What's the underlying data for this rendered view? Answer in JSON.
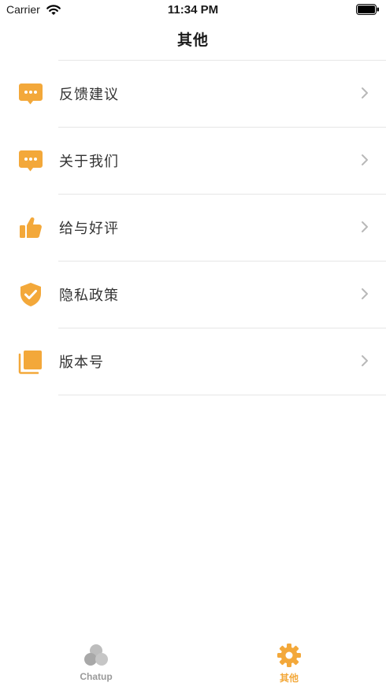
{
  "status_bar": {
    "carrier": "Carrier",
    "time": "11:34 PM",
    "wifi_icon": "wifi-icon",
    "battery_icon": "battery-icon"
  },
  "header": {
    "title": "其他"
  },
  "colors": {
    "accent": "#f3a83a",
    "inactive": "#9a9a9a",
    "divider": "#e6e6e6",
    "chevron": "#b8b8b8"
  },
  "menu": {
    "items": [
      {
        "label": "反馈建议",
        "icon": "chat-bubble-icon"
      },
      {
        "label": "关于我们",
        "icon": "chat-bubble-icon"
      },
      {
        "label": "给与好评",
        "icon": "thumbs-up-icon"
      },
      {
        "label": "隐私政策",
        "icon": "shield-check-icon"
      },
      {
        "label": "版本号",
        "icon": "stacked-pages-icon"
      }
    ]
  },
  "tab_bar": {
    "tabs": [
      {
        "label": "Chatup",
        "icon": "circles-cluster-icon",
        "active": false
      },
      {
        "label": "其他",
        "icon": "gear-icon",
        "active": true
      }
    ]
  }
}
